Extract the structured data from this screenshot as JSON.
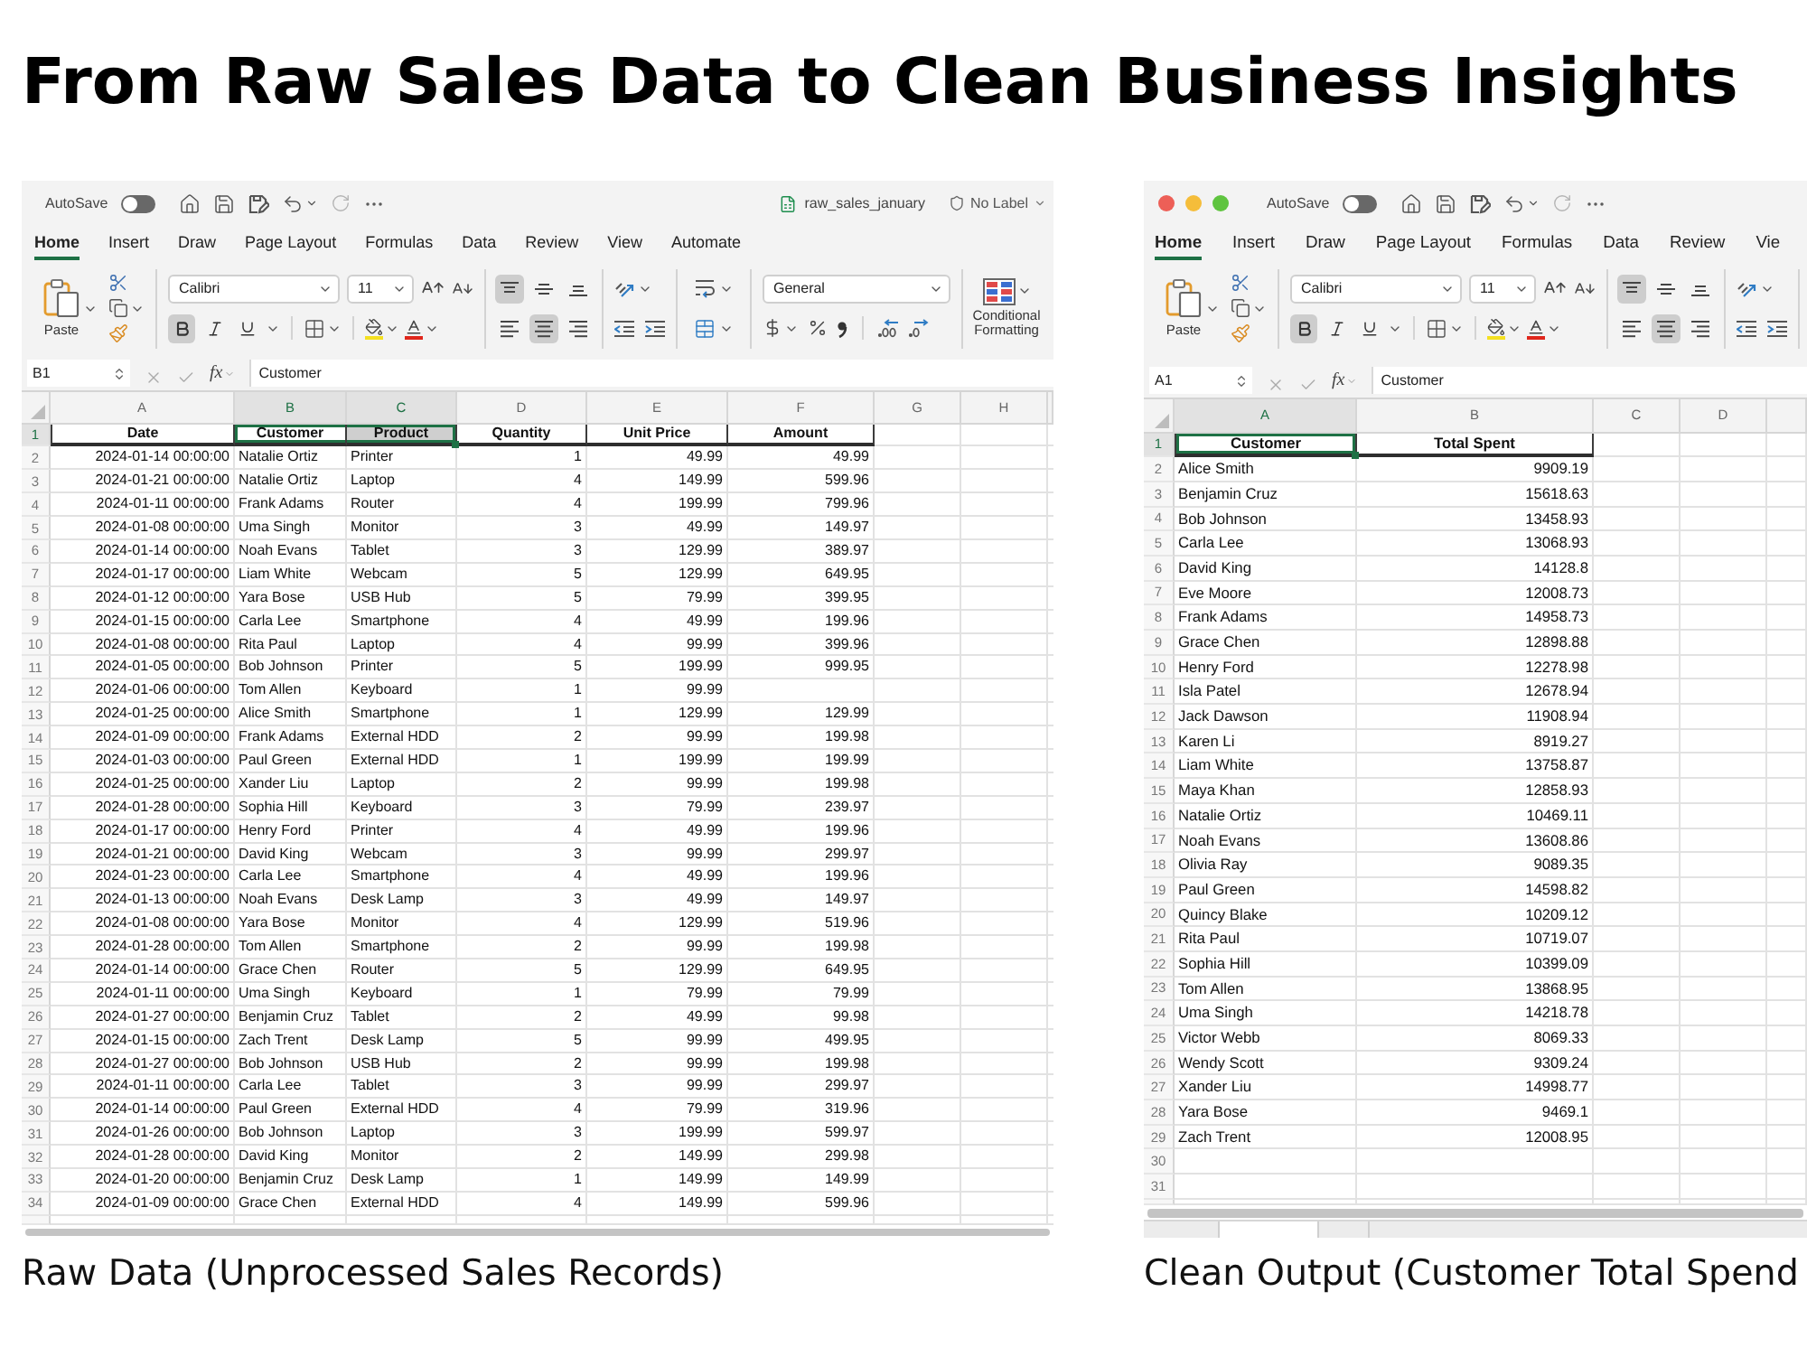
{
  "title": "From Raw Sales Data to Clean Business Insights",
  "panels": [
    {
      "caption": "Raw Data (Unprocessed Sales Records)",
      "window": {
        "autosave": {
          "label": "AutoSave",
          "on": false
        },
        "file_name": "raw_sales_january",
        "sensitivity": "No Label"
      },
      "tabs": [
        {
          "label": "Home",
          "selected": true
        },
        {
          "label": "Insert",
          "selected": false
        },
        {
          "label": "Draw",
          "selected": false
        },
        {
          "label": "Page Layout",
          "selected": false
        },
        {
          "label": "Formulas",
          "selected": false
        },
        {
          "label": "Data",
          "selected": false
        },
        {
          "label": "Review",
          "selected": false
        },
        {
          "label": "View",
          "selected": false
        },
        {
          "label": "Automate",
          "selected": false
        }
      ],
      "ribbon": [
        {
          "kind": "clipboard",
          "label": "Paste"
        },
        {
          "kind": "font",
          "font": "Calibri",
          "size": "11",
          "bold": true,
          "italic": false,
          "underline": false
        },
        {
          "kind": "alignment",
          "vertical": [
            {
              "kind": "top",
              "selected": true
            },
            {
              "kind": "middle",
              "selected": false
            },
            {
              "kind": "bottom",
              "selected": false
            }
          ],
          "horizontal": [
            {
              "kind": "left",
              "selected": false
            },
            {
              "kind": "center",
              "selected": true
            },
            {
              "kind": "right",
              "selected": false
            }
          ]
        },
        {
          "kind": "indent"
        },
        {
          "kind": "wrap"
        },
        {
          "kind": "number",
          "format": "General"
        },
        {
          "kind": "styles",
          "label": "Conditional Formatting"
        }
      ],
      "formula_bar": {
        "cell": "B1",
        "function_symbol": "fx",
        "content": "Customer"
      },
      "sheet": {
        "columns": [
          {
            "letter": "A",
            "kind": "date",
            "selected": false
          },
          {
            "letter": "B",
            "kind": "text",
            "selected": true
          },
          {
            "letter": "C",
            "kind": "text",
            "selected": true
          },
          {
            "letter": "D",
            "kind": "number",
            "selected": false
          },
          {
            "letter": "E",
            "kind": "number",
            "selected": false
          },
          {
            "letter": "F",
            "kind": "number",
            "selected": false
          },
          {
            "letter": "G",
            "selected": false
          },
          {
            "letter": "H",
            "selected": false
          }
        ],
        "header_row": {
          "number": "1",
          "selected": true,
          "cells": [
            {
              "text": "Date",
              "selected": false,
              "active": false
            },
            {
              "text": "Customer",
              "selected": true,
              "active": true
            },
            {
              "text": "Product",
              "selected": true,
              "active": false
            },
            {
              "text": "Quantity",
              "selected": false,
              "active": false
            },
            {
              "text": "Unit Price",
              "selected": false,
              "active": false
            },
            {
              "text": "Amount",
              "selected": false,
              "active": false
            }
          ]
        },
        "rows": [
          {
            "number": "2",
            "selected": false,
            "cells": [
              "2024-01-14 00:00:00",
              "Natalie Ortiz",
              "Printer",
              "1",
              "49.99",
              "49.99"
            ]
          },
          {
            "number": "3",
            "selected": false,
            "cells": [
              "2024-01-21 00:00:00",
              "Natalie Ortiz",
              "Laptop",
              "4",
              "149.99",
              "599.96"
            ]
          },
          {
            "number": "4",
            "selected": false,
            "cells": [
              "2024-01-11 00:00:00",
              "Frank Adams",
              "Router",
              "4",
              "199.99",
              "799.96"
            ]
          },
          {
            "number": "5",
            "selected": false,
            "cells": [
              "2024-01-08 00:00:00",
              "Uma Singh",
              "Monitor",
              "3",
              "49.99",
              "149.97"
            ]
          },
          {
            "number": "6",
            "selected": false,
            "cells": [
              "2024-01-14 00:00:00",
              "Noah Evans",
              "Tablet",
              "3",
              "129.99",
              "389.97"
            ]
          },
          {
            "number": "7",
            "selected": false,
            "cells": [
              "2024-01-17 00:00:00",
              "Liam White",
              "Webcam",
              "5",
              "129.99",
              "649.95"
            ]
          },
          {
            "number": "8",
            "selected": false,
            "cells": [
              "2024-01-12 00:00:00",
              "Yara Bose",
              "USB Hub",
              "5",
              "79.99",
              "399.95"
            ]
          },
          {
            "number": "9",
            "selected": false,
            "cells": [
              "2024-01-15 00:00:00",
              "Carla Lee",
              "Smartphone",
              "4",
              "49.99",
              "199.96"
            ]
          },
          {
            "number": "10",
            "selected": false,
            "cells": [
              "2024-01-08 00:00:00",
              "Rita Paul",
              "Laptop",
              "4",
              "99.99",
              "399.96"
            ]
          },
          {
            "number": "11",
            "selected": false,
            "cells": [
              "2024-01-05 00:00:00",
              "Bob Johnson",
              "Printer",
              "5",
              "199.99",
              "999.95"
            ]
          },
          {
            "number": "12",
            "selected": false,
            "cells": [
              "2024-01-06 00:00:00",
              "Tom Allen",
              "Keyboard",
              "1",
              "99.99",
              null
            ]
          },
          {
            "number": "13",
            "selected": false,
            "cells": [
              "2024-01-25 00:00:00",
              "Alice Smith",
              "Smartphone",
              "1",
              "129.99",
              "129.99"
            ]
          },
          {
            "number": "14",
            "selected": false,
            "cells": [
              "2024-01-09 00:00:00",
              "Frank Adams",
              "External HDD",
              "2",
              "99.99",
              "199.98"
            ]
          },
          {
            "number": "15",
            "selected": false,
            "cells": [
              "2024-01-03 00:00:00",
              "Paul Green",
              "External HDD",
              "1",
              "199.99",
              "199.99"
            ]
          },
          {
            "number": "16",
            "selected": false,
            "cells": [
              "2024-01-25 00:00:00",
              "Xander Liu",
              "Laptop",
              "2",
              "99.99",
              "199.98"
            ]
          },
          {
            "number": "17",
            "selected": false,
            "cells": [
              "2024-01-28 00:00:00",
              "Sophia Hill",
              "Keyboard",
              "3",
              "79.99",
              "239.97"
            ]
          },
          {
            "number": "18",
            "selected": false,
            "cells": [
              "2024-01-17 00:00:00",
              "Henry Ford",
              "Printer",
              "4",
              "49.99",
              "199.96"
            ]
          },
          {
            "number": "19",
            "selected": false,
            "cells": [
              "2024-01-21 00:00:00",
              "David King",
              "Webcam",
              "3",
              "99.99",
              "299.97"
            ]
          },
          {
            "number": "20",
            "selected": false,
            "cells": [
              "2024-01-23 00:00:00",
              "Carla Lee",
              "Smartphone",
              "4",
              "49.99",
              "199.96"
            ]
          },
          {
            "number": "21",
            "selected": false,
            "cells": [
              "2024-01-13 00:00:00",
              "Noah Evans",
              "Desk Lamp",
              "3",
              "49.99",
              "149.97"
            ]
          },
          {
            "number": "22",
            "selected": false,
            "cells": [
              "2024-01-08 00:00:00",
              "Yara Bose",
              "Monitor",
              "4",
              "129.99",
              "519.96"
            ]
          },
          {
            "number": "23",
            "selected": false,
            "cells": [
              "2024-01-28 00:00:00",
              "Tom Allen",
              "Smartphone",
              "2",
              "99.99",
              "199.98"
            ]
          },
          {
            "number": "24",
            "selected": false,
            "cells": [
              "2024-01-14 00:00:00",
              "Grace Chen",
              "Router",
              "5",
              "129.99",
              "649.95"
            ]
          },
          {
            "number": "25",
            "selected": false,
            "cells": [
              "2024-01-11 00:00:00",
              "Uma Singh",
              "Keyboard",
              "1",
              "79.99",
              "79.99"
            ]
          },
          {
            "number": "26",
            "selected": false,
            "cells": [
              "2024-01-27 00:00:00",
              "Benjamin Cruz",
              "Tablet",
              "2",
              "49.99",
              "99.98"
            ]
          },
          {
            "number": "27",
            "selected": false,
            "cells": [
              "2024-01-15 00:00:00",
              "Zach Trent",
              "Desk Lamp",
              "5",
              "99.99",
              "499.95"
            ]
          },
          {
            "number": "28",
            "selected": false,
            "cells": [
              "2024-01-27 00:00:00",
              "Bob Johnson",
              "USB Hub",
              "2",
              "99.99",
              "199.98"
            ]
          },
          {
            "number": "29",
            "selected": false,
            "cells": [
              "2024-01-11 00:00:00",
              "Carla Lee",
              "Tablet",
              "3",
              "99.99",
              "299.97"
            ]
          },
          {
            "number": "30",
            "selected": false,
            "cells": [
              "2024-01-14 00:00:00",
              "Paul Green",
              "External HDD",
              "4",
              "79.99",
              "319.96"
            ]
          },
          {
            "number": "31",
            "selected": false,
            "cells": [
              "2024-01-26 00:00:00",
              "Bob Johnson",
              "Laptop",
              "3",
              "199.99",
              "599.97"
            ]
          },
          {
            "number": "32",
            "selected": false,
            "cells": [
              "2024-01-28 00:00:00",
              "David King",
              "Monitor",
              "2",
              "149.99",
              "299.98"
            ]
          },
          {
            "number": "33",
            "selected": false,
            "cells": [
              "2024-01-20 00:00:00",
              "Benjamin Cruz",
              "Desk Lamp",
              "1",
              "149.99",
              "149.99"
            ]
          },
          {
            "number": "34",
            "selected": false,
            "cells": [
              "2024-01-09 00:00:00",
              "Grace Chen",
              "External HDD",
              "4",
              "149.99",
              "599.96"
            ]
          }
        ]
      }
    },
    {
      "caption": "Clean Output (Customer Total Spend",
      "window": {
        "traffic_lights": true,
        "autosave": {
          "label": "AutoSave",
          "on": false
        }
      },
      "tabs": [
        {
          "label": "Home",
          "selected": true
        },
        {
          "label": "Insert",
          "selected": false
        },
        {
          "label": "Draw",
          "selected": false
        },
        {
          "label": "Page Layout",
          "selected": false
        },
        {
          "label": "Formulas",
          "selected": false
        },
        {
          "label": "Data",
          "selected": false
        },
        {
          "label": "Review",
          "selected": false
        },
        {
          "label": "Vie",
          "selected": false
        }
      ],
      "ribbon": [
        {
          "kind": "clipboard",
          "label": "Paste"
        },
        {
          "kind": "font",
          "font": "Calibri",
          "size": "11",
          "bold": true,
          "italic": false,
          "underline": false
        },
        {
          "kind": "alignment",
          "vertical": [
            {
              "kind": "top",
              "selected": true
            },
            {
              "kind": "middle",
              "selected": false
            },
            {
              "kind": "bottom",
              "selected": false
            }
          ],
          "horizontal": [
            {
              "kind": "left",
              "selected": false
            },
            {
              "kind": "center",
              "selected": true
            },
            {
              "kind": "right",
              "selected": false
            }
          ]
        },
        {
          "kind": "indent"
        }
      ],
      "formula_bar": {
        "cell": "A1",
        "function_symbol": "fx",
        "content": "Customer"
      },
      "sheet": {
        "columns": [
          {
            "letter": "A",
            "kind": "text",
            "selected": true
          },
          {
            "letter": "B",
            "kind": "number",
            "selected": false
          },
          {
            "letter": "C",
            "selected": false
          },
          {
            "letter": "D",
            "selected": false
          }
        ],
        "header_row": {
          "number": "1",
          "selected": true,
          "cells": [
            {
              "text": "Customer",
              "selected": true,
              "active": true
            },
            {
              "text": "Total Spent",
              "selected": false,
              "active": false
            }
          ]
        },
        "rows": [
          {
            "number": "2",
            "selected": false,
            "cells": [
              "Alice Smith",
              "9909.19"
            ]
          },
          {
            "number": "3",
            "selected": false,
            "cells": [
              "Benjamin Cruz",
              "15618.63"
            ]
          },
          {
            "number": "4",
            "selected": false,
            "cells": [
              "Bob Johnson",
              "13458.93"
            ]
          },
          {
            "number": "5",
            "selected": false,
            "cells": [
              "Carla Lee",
              "13068.93"
            ]
          },
          {
            "number": "6",
            "selected": false,
            "cells": [
              "David King",
              "14128.8"
            ]
          },
          {
            "number": "7",
            "selected": false,
            "cells": [
              "Eve Moore",
              "12008.73"
            ]
          },
          {
            "number": "8",
            "selected": false,
            "cells": [
              "Frank Adams",
              "14958.73"
            ]
          },
          {
            "number": "9",
            "selected": false,
            "cells": [
              "Grace Chen",
              "12898.88"
            ]
          },
          {
            "number": "10",
            "selected": false,
            "cells": [
              "Henry Ford",
              "12278.98"
            ]
          },
          {
            "number": "11",
            "selected": false,
            "cells": [
              "Isla Patel",
              "12678.94"
            ]
          },
          {
            "number": "12",
            "selected": false,
            "cells": [
              "Jack Dawson",
              "11908.94"
            ]
          },
          {
            "number": "13",
            "selected": false,
            "cells": [
              "Karen Li",
              "8919.27"
            ]
          },
          {
            "number": "14",
            "selected": false,
            "cells": [
              "Liam White",
              "13758.87"
            ]
          },
          {
            "number": "15",
            "selected": false,
            "cells": [
              "Maya Khan",
              "12858.93"
            ]
          },
          {
            "number": "16",
            "selected": false,
            "cells": [
              "Natalie Ortiz",
              "10469.11"
            ]
          },
          {
            "number": "17",
            "selected": false,
            "cells": [
              "Noah Evans",
              "13608.86"
            ]
          },
          {
            "number": "18",
            "selected": false,
            "cells": [
              "Olivia Ray",
              "9089.35"
            ]
          },
          {
            "number": "19",
            "selected": false,
            "cells": [
              "Paul Green",
              "14598.82"
            ]
          },
          {
            "number": "20",
            "selected": false,
            "cells": [
              "Quincy Blake",
              "10209.12"
            ]
          },
          {
            "number": "21",
            "selected": false,
            "cells": [
              "Rita Paul",
              "10719.07"
            ]
          },
          {
            "number": "22",
            "selected": false,
            "cells": [
              "Sophia Hill",
              "10399.09"
            ]
          },
          {
            "number": "23",
            "selected": false,
            "cells": [
              "Tom Allen",
              "13868.95"
            ]
          },
          {
            "number": "24",
            "selected": false,
            "cells": [
              "Uma Singh",
              "14218.78"
            ]
          },
          {
            "number": "25",
            "selected": false,
            "cells": [
              "Victor Webb",
              "8069.33"
            ]
          },
          {
            "number": "26",
            "selected": false,
            "cells": [
              "Wendy Scott",
              "9309.24"
            ]
          },
          {
            "number": "27",
            "selected": false,
            "cells": [
              "Xander Liu",
              "14998.77"
            ]
          },
          {
            "number": "28",
            "selected": false,
            "cells": [
              "Yara Bose",
              "9469.1"
            ]
          },
          {
            "number": "29",
            "selected": false,
            "cells": [
              "Zach Trent",
              "12008.95"
            ]
          },
          {
            "number": "30",
            "selected": false
          },
          {
            "number": "31",
            "selected": false
          }
        ]
      }
    }
  ]
}
